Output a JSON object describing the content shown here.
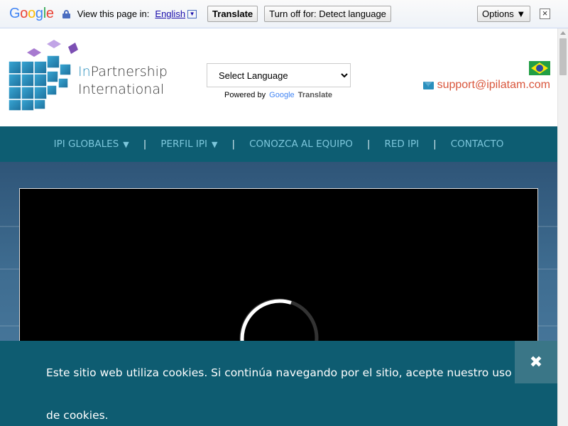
{
  "translate_bar": {
    "logo": "Google",
    "view_text": "View this page in:",
    "language": "English",
    "translate_label": "Translate",
    "turn_off_label": "Turn off for: Detect language",
    "options_label": "Options ▼",
    "close_label": "×"
  },
  "header": {
    "logo_line1_prefix": "In",
    "logo_line1_rest": "Partnership",
    "logo_line2": "International",
    "select_language": "Select Language",
    "powered_by": "Powered by",
    "powered_google": "Google",
    "powered_translate": "Translate",
    "support_email": "support@ipilatam.com"
  },
  "nav": {
    "items": [
      {
        "label": "IPI GLOBALES",
        "caret": "▼"
      },
      {
        "label": "PERFIL IPI",
        "caret": "▼"
      },
      {
        "label": "CONOZCA AL EQUIPO"
      },
      {
        "label": "RED IPI"
      },
      {
        "label": "CONTACTO"
      }
    ],
    "separator": "|"
  },
  "cookie_banner": {
    "text": "Este sitio web utiliza cookies. Si continúa navegando por el sitio, acepte nuestro uso de cookies.",
    "close_label": "✖"
  },
  "colors": {
    "nav_bg": "#0d5d72",
    "nav_text": "#7cc6db",
    "accent_email": "#d9553b",
    "logo_blue": "#2a8fbd"
  }
}
